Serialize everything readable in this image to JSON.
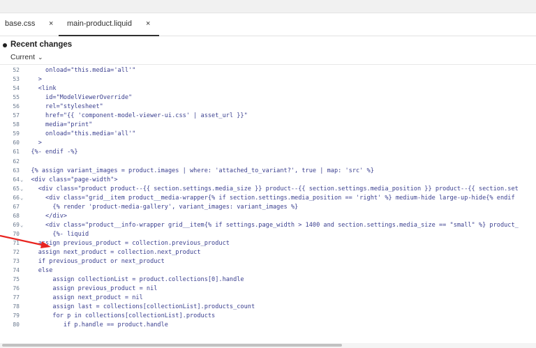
{
  "tabs": [
    {
      "label": "base.css",
      "close": "×"
    },
    {
      "label": "main-product.liquid",
      "close": "×"
    }
  ],
  "recent": {
    "title": "Recent changes",
    "version": "Current"
  },
  "lines": [
    {
      "n": "52",
      "t": "      onload=\"this.media='all'\""
    },
    {
      "n": "53",
      "t": "    >"
    },
    {
      "n": "54",
      "t": "    <link"
    },
    {
      "n": "55",
      "t": "      id=\"ModelViewerOverride\""
    },
    {
      "n": "56",
      "t": "      rel=\"stylesheet\""
    },
    {
      "n": "57",
      "t": "      href=\"{{ 'component-model-viewer-ui.css' | asset_url }}\""
    },
    {
      "n": "58",
      "t": "      media=\"print\""
    },
    {
      "n": "59",
      "t": "      onload=\"this.media='all'\""
    },
    {
      "n": "60",
      "t": "    >"
    },
    {
      "n": "61",
      "t": "  {%- endif -%}"
    },
    {
      "n": "62",
      "t": ""
    },
    {
      "n": "63",
      "t": "  {% assign variant_images = product.images | where: 'attached_to_variant?', true | map: 'src' %}"
    },
    {
      "n": "64",
      "t": "  <div class=\"page-width\">",
      "fold": "⌄"
    },
    {
      "n": "65",
      "t": "    <div class=\"product product--{{ section.settings.media_size }} product--{{ section.settings.media_position }} product--{{ section.set",
      "fold": "⌄"
    },
    {
      "n": "66",
      "t": "      <div class=\"grid__item product__media-wrapper{% if section.settings.media_position == 'right' %} medium-hide large-up-hide{% endif",
      "fold": "⌄"
    },
    {
      "n": "67",
      "t": "        {% render 'product-media-gallery', variant_images: variant_images %}"
    },
    {
      "n": "68",
      "t": "      </div>"
    },
    {
      "n": "69",
      "t": "      <div class=\"product__info-wrapper grid__item{% if settings.page_width > 1400 and section.settings.media_size == \"small\" %} product_",
      "fold": "⌄"
    },
    {
      "n": "70",
      "t": "        {%- liquid"
    },
    {
      "n": "71",
      "t": "    assign previous_product = collection.previous_product"
    },
    {
      "n": "72",
      "t": "    assign next_product = collection.next_product"
    },
    {
      "n": "73",
      "t": "    if previous_product or next_product"
    },
    {
      "n": "74",
      "t": "    else"
    },
    {
      "n": "75",
      "t": "        assign collectionList = product.collections[0].handle"
    },
    {
      "n": "76",
      "t": "        assign previous_product = nil"
    },
    {
      "n": "77",
      "t": "        assign next_product = nil"
    },
    {
      "n": "78",
      "t": "        assign last = collections[collectionList].products_count"
    },
    {
      "n": "79",
      "t": "        for p in collections[collectionList].products"
    },
    {
      "n": "80",
      "t": "           if p.handle == product.handle"
    }
  ],
  "colors": {
    "code": "#3a3f8f",
    "gutter": "#6b7a8f",
    "arrow": "#e8231f"
  },
  "icons": {
    "dot": "dot-icon",
    "chevron": "chevron-down-icon",
    "arrow": "arrow-icon"
  }
}
